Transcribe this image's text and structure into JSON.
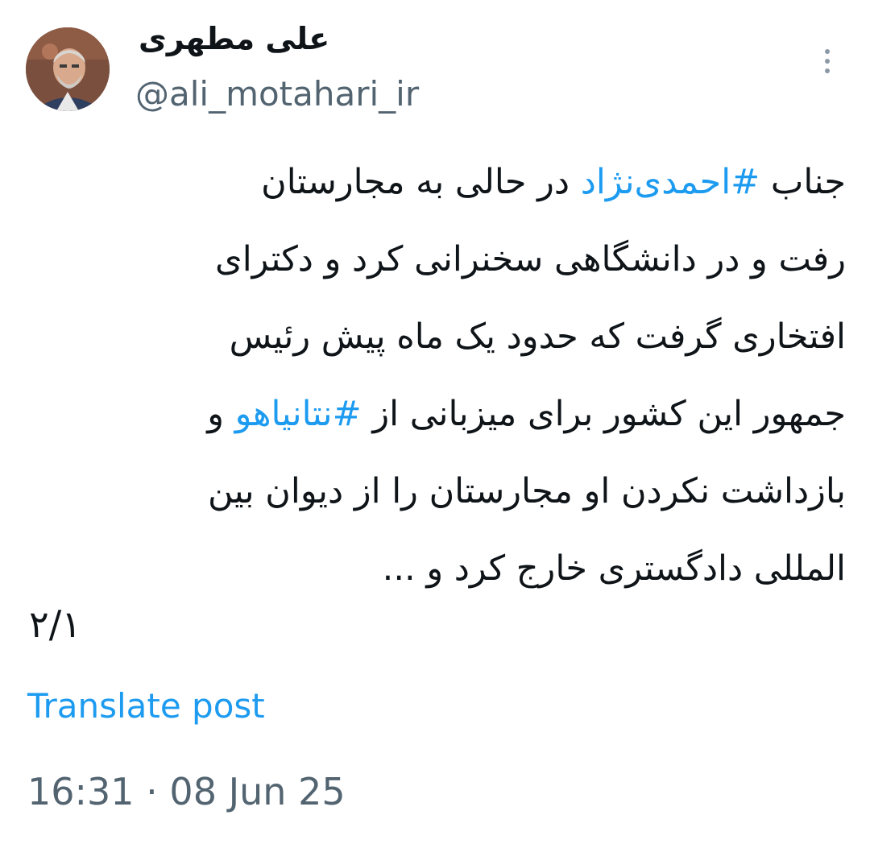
{
  "author": {
    "display_name": "علی مطهری",
    "handle": "@ali_motahari_ir",
    "avatar_icon": "profile-photo"
  },
  "menu": {
    "icon": "more-vertical-icon"
  },
  "tweet": {
    "lines": [
      {
        "before": "جناب ",
        "hashtag": "#احمدی‌نژاد",
        "after": " در حالی به مجارستان"
      },
      {
        "text": "رفت و در دانشگاهی سخنرانی کرد و دکترای"
      },
      {
        "text": "افتخاری گرفت که حدود یک ماه پیش رئیس"
      },
      {
        "before": "جمهور این کشور برای میزبانی از ",
        "hashtag": "#نتانیاهو",
        "after": " و"
      },
      {
        "text": "بازداشت نکردن او مجارستان را از دیوان بین"
      },
      {
        "text": "المللی دادگستری خارج کرد و ..."
      }
    ],
    "thread_count": "۲/۱"
  },
  "translate_label": "Translate post",
  "timestamp": "16:31 · 08 Jun 25",
  "colors": {
    "link": "#1d9bf0",
    "secondary_text": "#536471",
    "primary_text": "#0f1419"
  }
}
